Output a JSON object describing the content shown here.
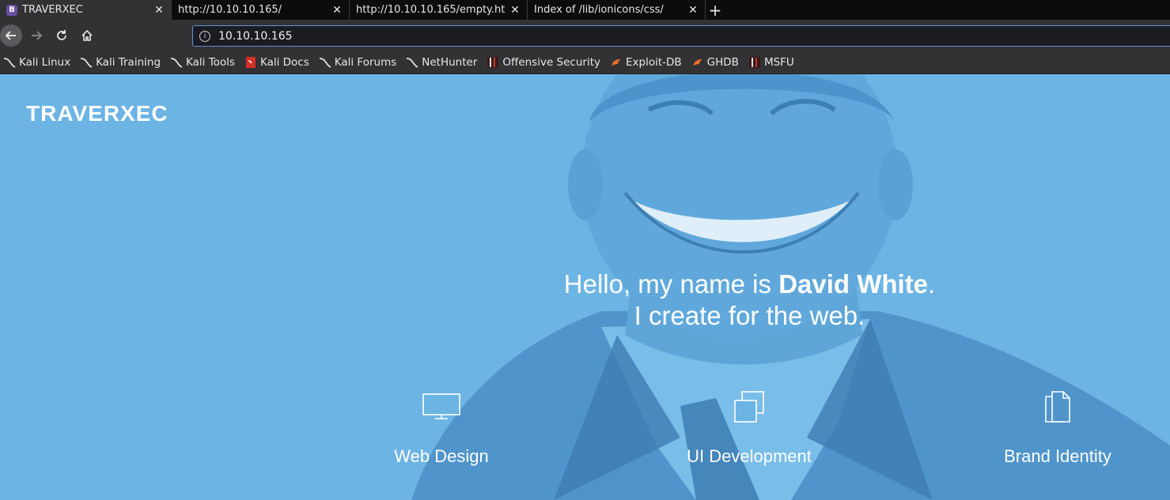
{
  "tabs": [
    {
      "title": "TRAVERXEC",
      "active": true,
      "favicon": "B"
    },
    {
      "title": "http://10.10.10.165/",
      "active": false
    },
    {
      "title": "http://10.10.10.165/empty.ht",
      "active": false
    },
    {
      "title": "Index of /lib/ionicons/css/",
      "active": false
    }
  ],
  "nav": {
    "url": "10.10.10.165"
  },
  "bookmarks": [
    {
      "label": "Kali Linux",
      "icon": "kali-dragon-icon"
    },
    {
      "label": "Kali Training",
      "icon": "kali-dragon-icon"
    },
    {
      "label": "Kali Tools",
      "icon": "kali-dragon-icon"
    },
    {
      "label": "Kali Docs",
      "icon": "kali-docs-icon"
    },
    {
      "label": "Kali Forums",
      "icon": "kali-dragon-icon"
    },
    {
      "label": "NetHunter",
      "icon": "kali-dragon-icon"
    },
    {
      "label": "Offensive Security",
      "icon": "offsec-icon"
    },
    {
      "label": "Exploit-DB",
      "icon": "exploitdb-icon"
    },
    {
      "label": "GHDB",
      "icon": "exploitdb-icon"
    },
    {
      "label": "MSFU",
      "icon": "offsec-icon"
    }
  ],
  "page": {
    "brand": "TRAVERXEC",
    "hello_prefix": "Hello, my name is ",
    "hello_name": "David White",
    "hello_suffix": ".",
    "hello_line2": "I create for the web.",
    "services": [
      {
        "label": "Web Design",
        "icon": "monitor-icon"
      },
      {
        "label": "UI Development",
        "icon": "windows-icon"
      },
      {
        "label": "Brand Identity",
        "icon": "documents-icon"
      }
    ],
    "accent_color": "#6cb4e4"
  }
}
